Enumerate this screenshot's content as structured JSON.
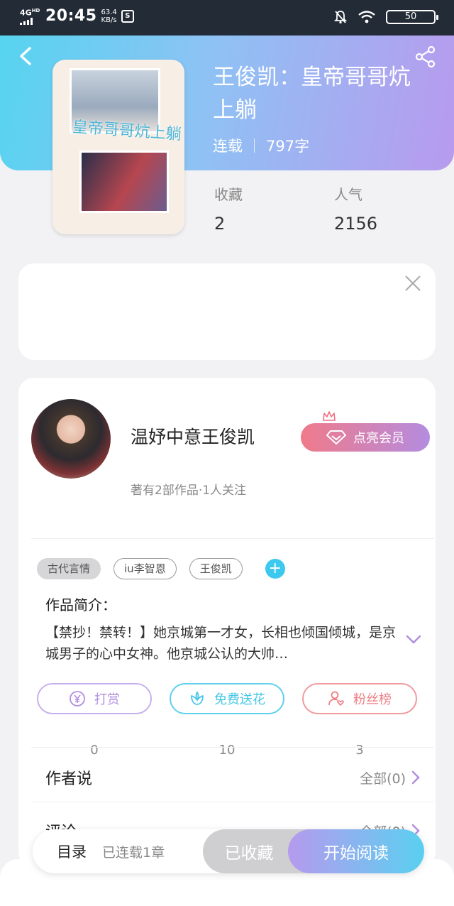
{
  "status_bar": {
    "network": "4G",
    "network_sup": "HD",
    "time": "20:45",
    "speed_value": "63.4",
    "speed_unit": "KB/s",
    "battery": "50"
  },
  "book": {
    "title": "王俊凯：皇帝哥哥炕上躺",
    "status": "连载",
    "word_count": "797字",
    "cover_title": "皇帝哥哥炕上躺",
    "stats": [
      {
        "label": "收藏",
        "value": "2"
      },
      {
        "label": "人气",
        "value": "2156"
      }
    ]
  },
  "author": {
    "name": "温妤中意王俊凯",
    "vip_label": "点亮会员",
    "summary": "著有2部作品·1人关注"
  },
  "tags": [
    "古代言情",
    "iu李智恩",
    "王俊凯"
  ],
  "intro": {
    "label": "作品简介：",
    "text": "【禁抄！禁转！】她京城第一才女，长相也倾国倾城，是京城男子的心中女神。他京城公认的大帅…"
  },
  "actions": [
    {
      "label": "打赏",
      "count": "0",
      "color": "#b28ee0"
    },
    {
      "label": "免费送花",
      "count": "10",
      "color": "#45c6e6"
    },
    {
      "label": "粉丝榜",
      "count": "3",
      "color": "#ee7f84"
    }
  ],
  "rows": [
    {
      "label": "作者说",
      "right": "全部(0)"
    },
    {
      "label": "评论",
      "right": "全部(0)"
    }
  ],
  "bottom": {
    "toc_label": "目录",
    "toc_status": "已连载1章",
    "fav_label": "已收藏",
    "read_label": "开始阅读"
  }
}
